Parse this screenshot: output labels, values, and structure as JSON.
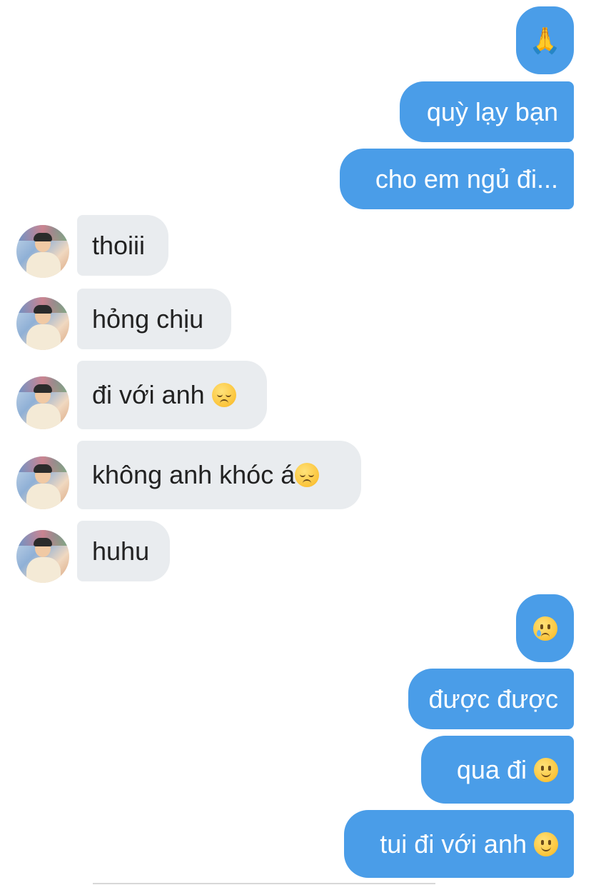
{
  "messages": [
    {
      "id": "m1",
      "direction": "outgoing",
      "text": "",
      "emoji": "folded-hands"
    },
    {
      "id": "m2",
      "direction": "outgoing",
      "text": "quỳ lạy bạn"
    },
    {
      "id": "m3",
      "direction": "outgoing",
      "text": "cho em ngủ đi..."
    },
    {
      "id": "m4",
      "direction": "incoming",
      "text": "thoiii"
    },
    {
      "id": "m5",
      "direction": "incoming",
      "text": "hỏng chịu"
    },
    {
      "id": "m6",
      "direction": "incoming",
      "text": "đi với anh ",
      "emoji": "pensive-face"
    },
    {
      "id": "m7",
      "direction": "incoming",
      "text": "không anh khóc á",
      "emoji": "pensive-face"
    },
    {
      "id": "m8",
      "direction": "incoming",
      "text": "huhu"
    },
    {
      "id": "m9",
      "direction": "outgoing",
      "text": "",
      "emoji": "face-holding-back-tears"
    },
    {
      "id": "m10",
      "direction": "outgoing",
      "text": "được được"
    },
    {
      "id": "m11",
      "direction": "outgoing",
      "text": "qua đi ",
      "emoji": "slightly-smiling-face"
    },
    {
      "id": "m12",
      "direction": "outgoing",
      "text": "tui đi với anh ",
      "emoji": "slightly-smiling-face"
    }
  ],
  "glyphs": {
    "folded_hands": "🙏"
  },
  "colors": {
    "outgoing_bubble": "#4a9de8",
    "incoming_bubble": "#e9ecef",
    "outgoing_text": "#ffffff",
    "incoming_text": "#222222"
  }
}
